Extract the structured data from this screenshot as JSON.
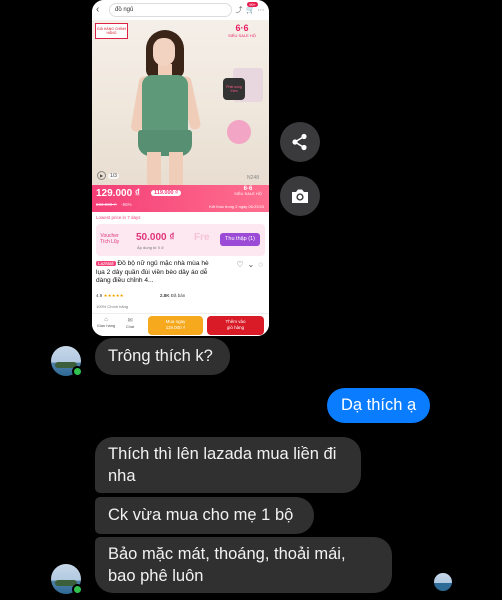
{
  "product_shot": {
    "search_text": "đồ ngủ",
    "cart_badge": "99+",
    "brand_logo": "GIÁ HÀNG CHÍNH HÃNG",
    "sale_badge_big": "6·6",
    "sale_badge_small": "SIÊU SALE HỘ",
    "chat_label": "Phát sóng",
    "chat_link": "Xem",
    "image_counter": "1/3",
    "product_code": "N248",
    "price": "129.000 ₫",
    "voucher_price": "119.000 ₫",
    "old_price": "269.000 ₫",
    "discount": "-56%",
    "flash_title": "6·6",
    "flash_sub": "SIÊU SALE HỘ",
    "ends_text": "Kết thúc trong 2 ngày 06:23:53",
    "lowest_note": "Lowest price in 7 days",
    "voucher_label_1": "Voucher",
    "voucher_label_2": "Tích Lũy",
    "voucher_value": "50.000 ₫",
    "voucher_sub": "Áp dụng từ 0 đ",
    "voucher_ghost": "Fre",
    "voucher_button": "Thu thập (1)",
    "lazmall_tag": "LazMall",
    "product_title": "Đồ bộ nữ ngủ mặc nhà mùa hè lụa 2 dây quần đùi viền bèo dây áo dễ dàng điều chỉnh 4...",
    "rating": "4.9",
    "stars": "★★★★★",
    "sold": "2.8K",
    "sold_label": "Đã bán",
    "guarantee": "100% Chính hãng",
    "nav_store": "Gian hàng",
    "nav_chat": "Chat",
    "buy_now": "Mua ngay",
    "buy_now_price": "119.000 ₫",
    "add_cart_1": "Thêm vào",
    "add_cart_2": "giỏ hàng"
  },
  "messages": {
    "m1": "Trông thích k?",
    "m2": "Dạ thích ạ",
    "m3_l1": "Thích thì lên lazada mua liền đi",
    "m3_l2": "nha",
    "m4": "Ck vừa mua cho mẹ 1 bộ",
    "m5_l1": "Bảo mặc mát, thoáng, thoải mái,",
    "m5_l2": "bao phê luôn"
  },
  "colors": {
    "background": "#000000",
    "incoming_bubble": "#303030",
    "outgoing_bubble": "#0a7cff",
    "online_dot": "#31c24d",
    "lazada_pink": "#f43f77"
  }
}
